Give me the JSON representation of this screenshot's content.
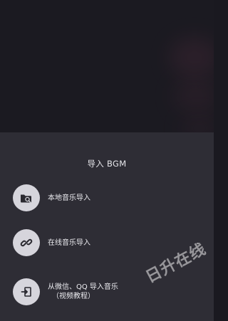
{
  "sheet": {
    "title": "导入 BGM",
    "options": [
      {
        "label": "本地音乐导入",
        "icon": "folder-search-icon"
      },
      {
        "label": "在线音乐导入",
        "icon": "link-icon"
      },
      {
        "label": "从微信、QQ 导入音乐",
        "sublabel": "（视频教程）",
        "icon": "import-icon"
      }
    ]
  },
  "watermark": {
    "text": "日升在线"
  },
  "colors": {
    "backdrop": "#1b1a21",
    "sheet": "#2e2d35",
    "icon_circle": "#d6d5dc",
    "icon_glyph": "#2a2930",
    "text": "#ececf0"
  }
}
